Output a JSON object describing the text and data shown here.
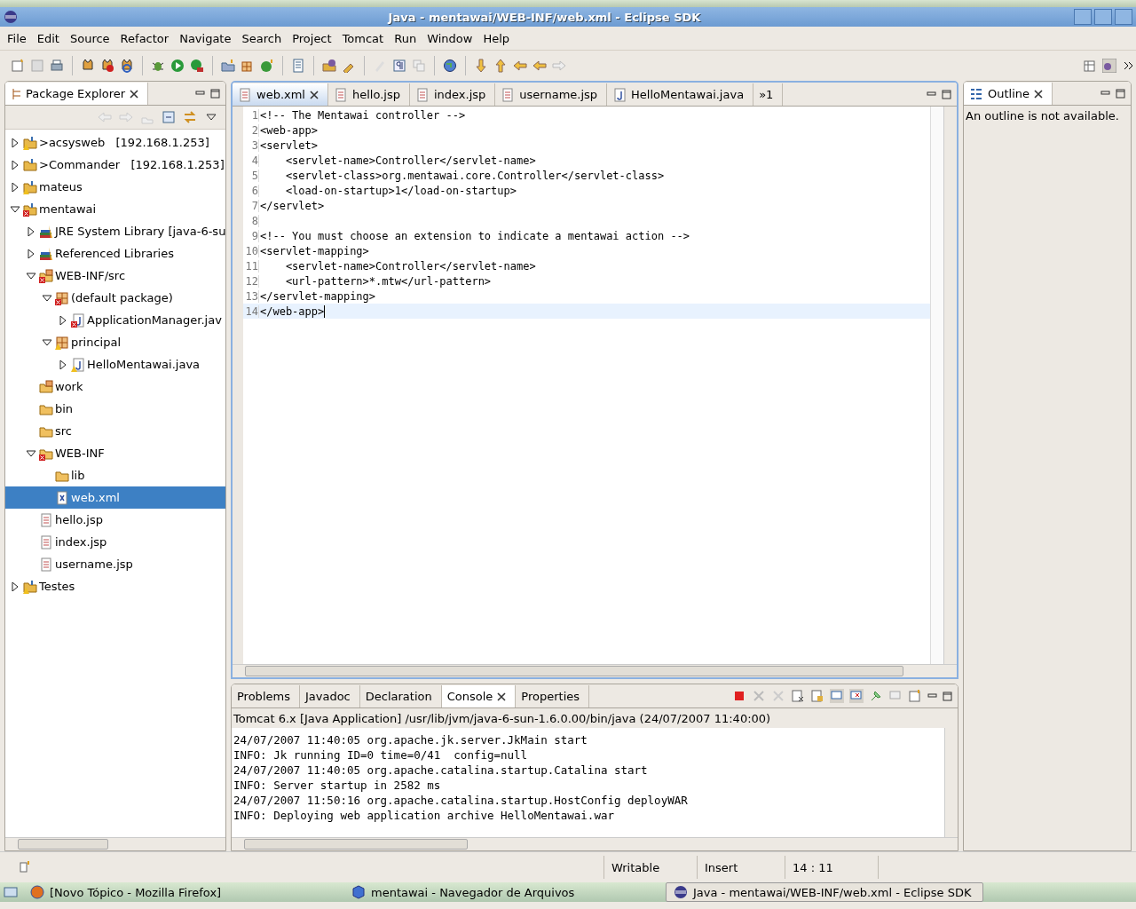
{
  "window": {
    "title": "Java - mentawai/WEB-INF/web.xml - Eclipse SDK"
  },
  "menu": [
    "File",
    "Edit",
    "Source",
    "Refactor",
    "Navigate",
    "Search",
    "Project",
    "Tomcat",
    "Run",
    "Window",
    "Help"
  ],
  "package_explorer": {
    "title": "Package Explorer",
    "tree": [
      {
        "label": ">acsysweb   [192.168.1.253]",
        "kind": "project",
        "warning": true,
        "expanded": false,
        "selected": false
      },
      {
        "label": ">Commander   [192.168.1.253]",
        "kind": "project",
        "expanded": false,
        "selected": false
      },
      {
        "label": "mateus",
        "kind": "project",
        "warning": true,
        "expanded": false,
        "selected": false
      },
      {
        "label": "mentawai",
        "kind": "project",
        "error": true,
        "expanded": true,
        "selected": false,
        "children": [
          {
            "label": "JRE System Library [java-6-su",
            "kind": "library",
            "expanded": false,
            "selected": false
          },
          {
            "label": "Referenced Libraries",
            "kind": "library",
            "expanded": false,
            "selected": false
          },
          {
            "label": "WEB-INF/src",
            "kind": "source-folder",
            "error": true,
            "expanded": true,
            "selected": false,
            "children": [
              {
                "label": "(default package)",
                "kind": "package",
                "error": true,
                "expanded": true,
                "selected": false,
                "children": [
                  {
                    "label": "ApplicationManager.jav",
                    "kind": "java",
                    "error": true,
                    "expanded": false,
                    "selected": false
                  }
                ]
              },
              {
                "label": "principal",
                "kind": "package",
                "warning": true,
                "expanded": true,
                "selected": false,
                "children": [
                  {
                    "label": "HelloMentawai.java",
                    "kind": "java",
                    "warning": true,
                    "expanded": false,
                    "selected": false
                  }
                ]
              }
            ]
          },
          {
            "label": "work",
            "kind": "source-folder",
            "selected": false
          },
          {
            "label": "bin",
            "kind": "folder",
            "selected": false
          },
          {
            "label": "src",
            "kind": "folder",
            "selected": false
          },
          {
            "label": "WEB-INF",
            "kind": "folder",
            "error": true,
            "expanded": true,
            "selected": false,
            "children": [
              {
                "label": "lib",
                "kind": "folder",
                "selected": false
              },
              {
                "label": "web.xml",
                "kind": "xml",
                "selected": true
              }
            ]
          },
          {
            "label": "hello.jsp",
            "kind": "file",
            "selected": false
          },
          {
            "label": "index.jsp",
            "kind": "file",
            "selected": false
          },
          {
            "label": "username.jsp",
            "kind": "file",
            "selected": false
          }
        ]
      },
      {
        "label": "Testes",
        "kind": "project",
        "warning": true,
        "expanded": false,
        "selected": false
      }
    ]
  },
  "editor": {
    "tabs": [
      {
        "label": "web.xml",
        "kind": "file",
        "selected": true
      },
      {
        "label": "hello.jsp",
        "kind": "file",
        "selected": false
      },
      {
        "label": "index.jsp",
        "kind": "file",
        "selected": false
      },
      {
        "label": "username.jsp",
        "kind": "file",
        "selected": false
      },
      {
        "label": "HelloMentawai.java",
        "kind": "java",
        "selected": false
      }
    ],
    "overflow": "»1",
    "lines": [
      {
        "number": "1",
        "text": "<!-- The Mentawai controller -->",
        "current": false
      },
      {
        "number": "2",
        "text": "<web-app>",
        "current": false
      },
      {
        "number": "3",
        "text": "<servlet>",
        "current": false
      },
      {
        "number": "4",
        "text": "    <servlet-name>Controller</servlet-name>",
        "current": false
      },
      {
        "number": "5",
        "text": "    <servlet-class>org.mentawai.core.Controller</servlet-class>",
        "current": false
      },
      {
        "number": "6",
        "text": "    <load-on-startup>1</load-on-startup>",
        "current": false
      },
      {
        "number": "7",
        "text": "</servlet>",
        "current": false
      },
      {
        "number": "8",
        "current": false
      },
      {
        "number": "9",
        "text": "<!-- You must choose an extension to indicate a mentawai action -->",
        "current": false
      },
      {
        "number": "10",
        "text": "<servlet-mapping>",
        "current": false
      },
      {
        "number": "11",
        "text": "    <servlet-name>Controller</servlet-name>",
        "current": false
      },
      {
        "number": "12",
        "text": "    <url-pattern>*.mtw</url-pattern>",
        "current": false
      },
      {
        "number": "13",
        "text": "</servlet-mapping>",
        "current": false
      },
      {
        "number": "14",
        "text": "</web-app>",
        "current": true
      }
    ]
  },
  "outline": {
    "title": "Outline",
    "message": "An outline is not available."
  },
  "bottom_panel": {
    "tabs": [
      {
        "label": "Problems",
        "selected": false
      },
      {
        "label": "Javadoc",
        "selected": false
      },
      {
        "label": "Declaration",
        "selected": false
      },
      {
        "label": "Console",
        "selected": true
      },
      {
        "label": "Properties",
        "selected": false
      }
    ],
    "console_title": "Tomcat 6.x [Java Application] /usr/lib/jvm/java-6-sun-1.6.0.00/bin/java (24/07/2007 11:40:00)",
    "console_lines": [
      "24/07/2007 11:40:05 org.apache.jk.server.JkMain start",
      "INFO: Jk running ID=0 time=0/41  config=null",
      "24/07/2007 11:40:05 org.apache.catalina.startup.Catalina start",
      "INFO: Server startup in 2582 ms",
      "24/07/2007 11:50:16 org.apache.catalina.startup.HostConfig deployWAR",
      "INFO: Deploying web application archive HelloMentawai.war"
    ]
  },
  "status_bar": {
    "mode": "Writable",
    "insert": "Insert",
    "position": "14 : 11"
  },
  "taskbar": [
    {
      "label": "[Novo Tópico - Mozilla Firefox]",
      "kind": "browser",
      "selected": false
    },
    {
      "label": "mentawai - Navegador de Arquivos",
      "kind": "files",
      "selected": false
    },
    {
      "label": "Java - mentawai/WEB-INF/web.xml - Eclipse SDK",
      "kind": "ide",
      "selected": true
    }
  ]
}
